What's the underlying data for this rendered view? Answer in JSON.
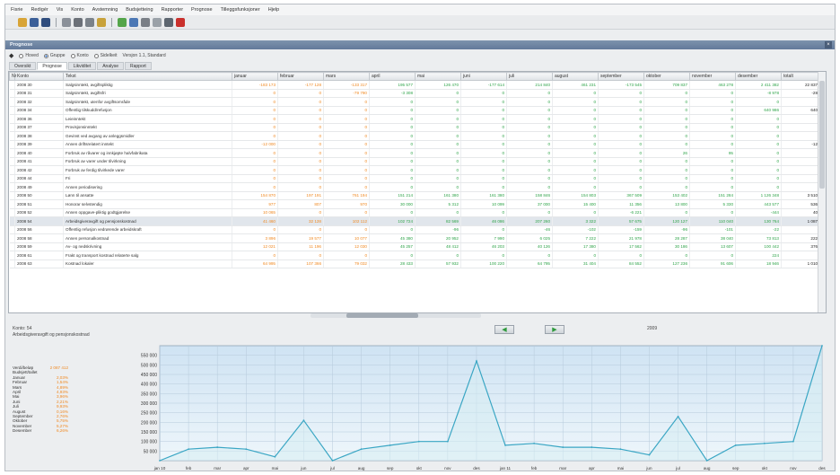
{
  "menu": [
    "Fisrie",
    "Redigér",
    "Vis",
    "Konto",
    "Avstemning",
    "Budsjetteing",
    "Rapporter",
    "Prognose",
    "Tilleggsfunksjoner",
    "Hjelp"
  ],
  "toolbar_icons": [
    "folder-icon",
    "save-icon",
    "disk-icon",
    "copy-icon",
    "print-icon",
    "preview-icon",
    "money-icon",
    "chart-icon",
    "undo-icon",
    "cut-icon",
    "paste-icon",
    "delete-icon",
    "help-icon"
  ],
  "window_title": "Prognose",
  "filters": {
    "options": [
      {
        "label": "Hoved",
        "checked": false
      },
      {
        "label": "Gruppe",
        "checked": true
      },
      {
        "label": "Konto",
        "checked": false
      },
      {
        "label": "Sidelkeit",
        "checked": false
      }
    ],
    "version_label": "Versjon 1.1, Standard"
  },
  "tabs": [
    "Oversikt",
    "Prognose",
    "Likviditet",
    "Analyse",
    "Rapport"
  ],
  "table": {
    "columns": [
      "Nr",
      "Konto",
      "Tekst",
      "januar",
      "februar",
      "mars",
      "april",
      "mai",
      "juni",
      "juli",
      "august",
      "september",
      "oktober",
      "november",
      "desember",
      "totalt"
    ],
    "rows": [
      {
        "code": "2008 30",
        "name": "Salgsinntekt, avgiftspliktig",
        "cells": [
          "-183 173",
          "-177 128",
          "-133 317",
          "195 577",
          "126 470",
          "-177 614",
          "214 840",
          "461 231",
          "-173 545",
          "709 837",
          "463 278",
          "2 411 382",
          "22 837 576"
        ]
      },
      {
        "code": "2008 31",
        "name": "Salgsinntekt, avgiftsfri",
        "cells": [
          "0",
          "0",
          "-79 790",
          "-3 308",
          "0",
          "0",
          "0",
          "0",
          "0",
          "0",
          "0",
          "-8 978",
          "-28 063"
        ]
      },
      {
        "code": "2008 32",
        "name": "Salgsinntekt, utenfor avgiftsområde",
        "cells": [
          "0",
          "0",
          "0",
          "0",
          "0",
          "0",
          "0",
          "0",
          "0",
          "0",
          "0",
          "0",
          "0"
        ]
      },
      {
        "code": "2008 34",
        "name": "Offentlig tilskudd/refusjon",
        "cells": [
          "0",
          "0",
          "0",
          "0",
          "0",
          "0",
          "0",
          "0",
          "0",
          "0",
          "0",
          "640 986",
          "640 986"
        ]
      },
      {
        "code": "2008 36",
        "name": "Leieinntekt",
        "cells": [
          "0",
          "0",
          "0",
          "0",
          "0",
          "0",
          "0",
          "0",
          "0",
          "0",
          "0",
          "0",
          "0"
        ]
      },
      {
        "code": "2008 37",
        "name": "Provisjonsinntekt",
        "cells": [
          "0",
          "0",
          "0",
          "0",
          "0",
          "0",
          "0",
          "0",
          "0",
          "0",
          "0",
          "0",
          "0"
        ]
      },
      {
        "code": "2008 38",
        "name": "Gevinst ved avgang av anleggsmidler",
        "cells": [
          "0",
          "0",
          "0",
          "0",
          "0",
          "0",
          "0",
          "0",
          "0",
          "0",
          "0",
          "0",
          "0"
        ]
      },
      {
        "code": "2008 39",
        "name": "Annen driftsrelatert inntekt",
        "cells": [
          "-12 000",
          "0",
          "0",
          "0",
          "0",
          "0",
          "0",
          "0",
          "0",
          "0",
          "0",
          "0",
          "-12 000"
        ]
      },
      {
        "code": "2008 40",
        "name": "Forbruk av råvarer og innkjøpte halvfabrikata",
        "cells": [
          "0",
          "0",
          "0",
          "0",
          "0",
          "0",
          "0",
          "0",
          "0",
          "26",
          "95",
          "0",
          "121"
        ]
      },
      {
        "code": "2008 41",
        "name": "Forbruk av varer under tilvirkning",
        "cells": [
          "0",
          "0",
          "0",
          "0",
          "0",
          "0",
          "0",
          "0",
          "0",
          "0",
          "0",
          "0",
          "0"
        ]
      },
      {
        "code": "2008 42",
        "name": "Forbruk av ferdig tilvirkede varer",
        "cells": [
          "0",
          "0",
          "0",
          "0",
          "0",
          "0",
          "0",
          "0",
          "0",
          "0",
          "0",
          "0",
          "0"
        ]
      },
      {
        "code": "2008 44",
        "name": "Fri",
        "cells": [
          "0",
          "0",
          "0",
          "0",
          "0",
          "0",
          "0",
          "0",
          "0",
          "0",
          "0",
          "0",
          "0"
        ]
      },
      {
        "code": "2008 49",
        "name": "Annen periodisering",
        "cells": [
          "0",
          "0",
          "0",
          "0",
          "0",
          "0",
          "0",
          "0",
          "0",
          "0",
          "0",
          "0",
          "0"
        ]
      },
      {
        "code": "2008 50",
        "name": "Lønn til ansatte",
        "cells": [
          "154 870",
          "197 191",
          "761 194",
          "151 214",
          "161 380",
          "161 380",
          "158 846",
          "154 803",
          "367 509",
          "153 402",
          "151 284",
          "1 126 348",
          "3 510 560"
        ]
      },
      {
        "code": "2008 51",
        "name": "Honorar selvstendig",
        "cells": [
          "977",
          "807",
          "970",
          "30 000",
          "5 312",
          "10 099",
          "37 000",
          "15 400",
          "11 356",
          "13 800",
          "5 330",
          "443 577",
          "536 150"
        ]
      },
      {
        "code": "2008 52",
        "name": "Annen oppgave-pliktig godtgjørelse",
        "cells": [
          "10 065",
          "0",
          "0",
          "0",
          "0",
          "0",
          "0",
          "0",
          "-6 221",
          "0",
          "0",
          "-444",
          "40 310"
        ]
      },
      {
        "code": "2008 54",
        "name": "Arbeidsgiveravgift og pensjonskostnad",
        "cells": [
          "41 460",
          "32 128",
          "102 112",
          "102 724",
          "82 569",
          "46 086",
          "207 260",
          "3 322",
          "57 675",
          "120 127",
          "110 040",
          "130 764",
          "1 087 412"
        ]
      },
      {
        "code": "2008 56",
        "name": "Offentlig refusjon vedrørende arbeidskraft",
        "cells": [
          "0",
          "0",
          "0",
          "0",
          "-96",
          "0",
          "-46",
          "-102",
          "-159",
          "-96",
          "-101",
          "-22",
          "-622"
        ]
      },
      {
        "code": "2008 58",
        "name": "Annen personalkostnad",
        "cells": [
          "3 896",
          "19 577",
          "10 077",
          "45 380",
          "20 952",
          "7 990",
          "6 025",
          "7 222",
          "21 978",
          "28 287",
          "38 040",
          "73 813",
          "222 863"
        ]
      },
      {
        "code": "2008 59",
        "name": "Av- og nedskrivning",
        "cells": [
          "12 021",
          "11 196",
          "12 030",
          "45 257",
          "48 412",
          "46 203",
          "40 126",
          "17 380",
          "17 562",
          "30 186",
          "13 607",
          "100 442",
          "376 188"
        ]
      },
      {
        "code": "2008 61",
        "name": "Frakt og transport kostnad relaterte salg",
        "cells": [
          "0",
          "0",
          "0",
          "0",
          "0",
          "0",
          "0",
          "0",
          "0",
          "0",
          "0",
          "224",
          "224"
        ]
      },
      {
        "code": "2008 63",
        "name": "Kostnad lokaler",
        "cells": [
          "64 995",
          "107 366",
          "79 032",
          "28 433",
          "57 932",
          "100 220",
          "64 795",
          "31 404",
          "84 552",
          "127 236",
          "91 606",
          "18 946",
          "1 010 334"
        ]
      }
    ],
    "highlight_row_index": 16
  },
  "chart_panel": {
    "label_konto": "Konto:",
    "label_konto_value": "54",
    "label_name": "Arbeidsgiveravgift og pensjonskostnad",
    "year_label": "2009",
    "summary": [
      {
        "label": "Verdi/beløp",
        "value": "2 087 412"
      },
      {
        "label": "Budsjett/tallet",
        "value": ""
      },
      {
        "label": "Januar",
        "value": "2,03%"
      },
      {
        "label": "Februar",
        "value": "1,54%"
      },
      {
        "label": "Mars",
        "value": "4,89%"
      },
      {
        "label": "April",
        "value": "4,93%"
      },
      {
        "label": "Mai",
        "value": "3,96%"
      },
      {
        "label": "Juni",
        "value": "2,21%"
      },
      {
        "label": "Juli",
        "value": "9,93%"
      },
      {
        "label": "August",
        "value": "0,16%"
      },
      {
        "label": "September",
        "value": "2,76%"
      },
      {
        "label": "Oktober",
        "value": "5,75%"
      },
      {
        "label": "November",
        "value": "5,27%"
      },
      {
        "label": "Desember",
        "value": "6,26%"
      }
    ]
  },
  "chart_data": {
    "type": "line",
    "categories": [
      "jan 10",
      "feb",
      "mar",
      "apr",
      "mai",
      "jun",
      "jul",
      "aug",
      "sep",
      "okt",
      "nov",
      "des",
      "jan 11",
      "feb",
      "mar",
      "apr",
      "mai",
      "jun",
      "jul",
      "aug",
      "sep",
      "okt",
      "nov",
      "des"
    ],
    "series": [
      {
        "values": [
          0,
          60000,
          70000,
          60000,
          20000,
          210000,
          0,
          60000,
          80000,
          100000,
          100000,
          520000,
          80000,
          90000,
          70000,
          70000,
          60000,
          30000,
          230000,
          0,
          80000,
          90000,
          100000,
          600000
        ]
      }
    ],
    "ylim": [
      0,
      600000
    ],
    "yticks": [
      "50 000",
      "100 000",
      "150 000",
      "200 000",
      "250 000",
      "300 000",
      "350 000",
      "400 000",
      "450 000",
      "500 000",
      "550 000"
    ],
    "ytick_values": [
      50000,
      100000,
      150000,
      200000,
      250000,
      300000,
      350000,
      400000,
      450000,
      500000,
      550000
    ],
    "grid": true,
    "colors": {
      "line": "#3aa6c4",
      "fill_top": "#cfe3f3",
      "fill_bottom": "#eef6fb",
      "grid": "#b6cadb"
    }
  }
}
